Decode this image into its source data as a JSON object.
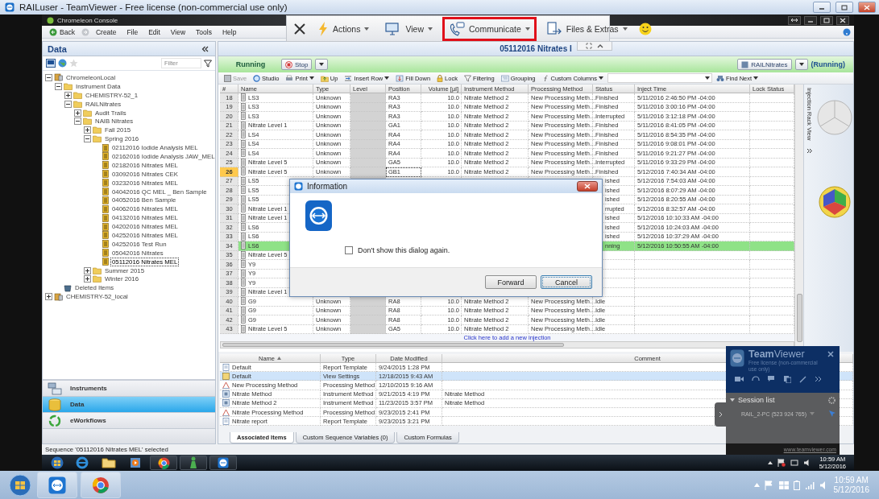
{
  "teamviewer_title": "RAILuser - TeamViewer - Free license (non-commercial use only)",
  "remote_toolbar": {
    "items": [
      {
        "label": "Actions",
        "highlighted": false
      },
      {
        "label": "View",
        "highlighted": false
      },
      {
        "label": "Communicate",
        "highlighted": true
      },
      {
        "label": "Files & Extras",
        "highlighted": false
      }
    ]
  },
  "app": {
    "title": "Chromeleon Console",
    "menu": [
      "Back",
      "Create",
      "File",
      "Edit",
      "View",
      "Tools",
      "Help"
    ]
  },
  "data_panel": {
    "title": "Data",
    "filter": {
      "placeholder": "Filter"
    },
    "tree": [
      {
        "label": "ChromeleonLocal",
        "kind": "server",
        "expanded": true,
        "selected": false,
        "children": [
          {
            "label": "Instrument Data",
            "kind": "folder",
            "expanded": true,
            "selected": false,
            "children": [
              {
                "label": "CHEMISTRY-52_1",
                "kind": "folder",
                "expanded": false,
                "selected": false
              },
              {
                "label": "RAILNitrates",
                "kind": "folder",
                "expanded": true,
                "selected": false,
                "children": [
                  {
                    "label": "Audit Trails",
                    "kind": "folder",
                    "expanded": false,
                    "selected": false
                  },
                  {
                    "label": "NAIB Nitrates",
                    "kind": "folder",
                    "expanded": true,
                    "selected": false,
                    "children": [
                      {
                        "label": "Fall 2015",
                        "kind": "folder",
                        "expanded": false,
                        "selected": false
                      },
                      {
                        "label": "Spring 2016",
                        "kind": "folder",
                        "expanded": true,
                        "selected": false,
                        "children": [
                          {
                            "label": "02112016 Iodide Analysis MEL",
                            "kind": "sequence",
                            "selected": false
                          },
                          {
                            "label": "02162016 Iodide Analysis JAW_MEL",
                            "kind": "sequence",
                            "selected": false
                          },
                          {
                            "label": "02182016 Nitrates MEL",
                            "kind": "sequence",
                            "selected": false
                          },
                          {
                            "label": "03092016 Nitrates CEK",
                            "kind": "sequence",
                            "selected": false
                          },
                          {
                            "label": "03232016 Nitrates MEL",
                            "kind": "sequence",
                            "selected": false
                          },
                          {
                            "label": "04042016 QC MEL _ Ben Sample",
                            "kind": "sequence",
                            "selected": false
                          },
                          {
                            "label": "04052016 Ben Sample",
                            "kind": "sequence",
                            "selected": false
                          },
                          {
                            "label": "04062016 Nitrates MEL",
                            "kind": "sequence",
                            "selected": false
                          },
                          {
                            "label": "04132016 Nitrates MEL",
                            "kind": "sequence",
                            "selected": false
                          },
                          {
                            "label": "04202016 Nitrates MEL",
                            "kind": "sequence",
                            "selected": false
                          },
                          {
                            "label": "04252016 Nitrates MEL",
                            "kind": "sequence",
                            "selected": false
                          },
                          {
                            "label": "04252016 Test Run",
                            "kind": "sequence",
                            "selected": false
                          },
                          {
                            "label": "05042016 Nitrates",
                            "kind": "sequence",
                            "selected": false
                          },
                          {
                            "label": "05112016 Nitrates MEL",
                            "kind": "sequence",
                            "selected": true
                          }
                        ]
                      },
                      {
                        "label": "Summer 2015",
                        "kind": "folder",
                        "expanded": false,
                        "selected": false
                      },
                      {
                        "label": "Winter 2016",
                        "kind": "folder",
                        "expanded": false,
                        "selected": false
                      }
                    ]
                  }
                ]
              }
            ]
          },
          {
            "label": "Deleted Items",
            "kind": "trash",
            "selected": false
          }
        ]
      },
      {
        "label": "CHEMISTRY-52_local",
        "kind": "server",
        "expanded": false,
        "selected": false
      }
    ],
    "nav": [
      {
        "label": "Instruments",
        "selected": false
      },
      {
        "label": "Data",
        "selected": true
      },
      {
        "label": "eWorkflows",
        "selected": false
      }
    ]
  },
  "sequence": {
    "title": "05112016 Nitrates I",
    "state": "Running",
    "stop": "Stop",
    "instrument": "RAILNitrates",
    "instrument_state": "(Running)",
    "toolbar": [
      {
        "label": "Save",
        "disabled": true,
        "menu": false
      },
      {
        "label": "Studio",
        "disabled": false,
        "menu": false
      },
      {
        "label": "Print",
        "disabled": false,
        "menu": true
      },
      {
        "label": "Up",
        "disabled": false,
        "menu": false
      },
      {
        "label": "Insert Row",
        "disabled": false,
        "menu": true
      },
      {
        "label": "Fill Down",
        "disabled": false,
        "menu": false
      },
      {
        "label": "Lock",
        "disabled": false,
        "menu": false
      },
      {
        "label": "Filtering",
        "disabled": false,
        "menu": false
      },
      {
        "label": "Grouping",
        "disabled": false,
        "menu": false
      },
      {
        "label": "Custom Columns",
        "disabled": false,
        "menu": true
      }
    ],
    "find": "Find Next",
    "columns": [
      "#",
      "Name",
      "Type",
      "Level",
      "Position",
      "Volume [µl]",
      "Instrument Method",
      "Processing Method",
      "Status",
      "Inject Time",
      "Lock Status"
    ],
    "rows": [
      {
        "no": "18",
        "name": "LS3",
        "type": "Unknown",
        "position": "RA3",
        "volume": "10.0",
        "instrument_method": "Nitrate Method 2",
        "processing_method": "New Processing Meth…",
        "status": "Finished",
        "inject_time": "5/11/2016 2:46:50 PM -04:00",
        "kind": "row",
        "current": false,
        "selected": false
      },
      {
        "no": "19",
        "name": "LS3",
        "type": "Unknown",
        "position": "RA3",
        "volume": "10.0",
        "instrument_method": "Nitrate Method 2",
        "processing_method": "New Processing Meth…",
        "status": "Finished",
        "inject_time": "5/11/2016 3:00:16 PM -04:00",
        "kind": "row",
        "current": false,
        "selected": false
      },
      {
        "no": "20",
        "name": "LS3",
        "type": "Unknown",
        "position": "RA3",
        "volume": "10.0",
        "instrument_method": "Nitrate Method 2",
        "processing_method": "New Processing Meth…",
        "status": "Interrupted",
        "inject_time": "5/11/2016 3:12:18 PM -04:00",
        "kind": "row",
        "current": false,
        "selected": false
      },
      {
        "no": "21",
        "name": "Nitrate Level 1",
        "type": "Unknown",
        "position": "GA1",
        "volume": "10.0",
        "instrument_method": "Nitrate Method 2",
        "processing_method": "New Processing Meth…",
        "status": "Finished",
        "inject_time": "5/11/2016 8:41:05 PM -04:00",
        "kind": "row",
        "current": false,
        "selected": false
      },
      {
        "no": "22",
        "name": "LS4",
        "type": "Unknown",
        "position": "RA4",
        "volume": "10.0",
        "instrument_method": "Nitrate Method 2",
        "processing_method": "New Processing Meth…",
        "status": "Finished",
        "inject_time": "5/11/2016 8:54:35 PM -04:00",
        "kind": "row",
        "current": false,
        "selected": false
      },
      {
        "no": "23",
        "name": "LS4",
        "type": "Unknown",
        "position": "RA4",
        "volume": "10.0",
        "instrument_method": "Nitrate Method 2",
        "processing_method": "New Processing Meth…",
        "status": "Finished",
        "inject_time": "5/11/2016 9:08:01 PM -04:00",
        "kind": "row",
        "current": false,
        "selected": false
      },
      {
        "no": "24",
        "name": "LS4",
        "type": "Unknown",
        "position": "RA4",
        "volume": "10.0",
        "instrument_method": "Nitrate Method 2",
        "processing_method": "New Processing Meth…",
        "status": "Finished",
        "inject_time": "5/11/2016 9:21:27 PM -04:00",
        "kind": "row",
        "current": false,
        "selected": false
      },
      {
        "no": "25",
        "name": "Nitrate Level 5",
        "type": "Unknown",
        "position": "GA5",
        "volume": "10.0",
        "instrument_method": "Nitrate Method 2",
        "processing_method": "New Processing Meth…",
        "status": "Interrupted",
        "inject_time": "5/11/2016 9:33:29 PM -04:00",
        "kind": "row",
        "current": false,
        "selected": false
      },
      {
        "no": "26",
        "name": "Nitrate Level 5",
        "type": "Unknown",
        "position": "GB1",
        "volume": "10.0",
        "instrument_method": "Nitrate Method 2",
        "processing_method": "New Processing Meth…",
        "status": "Finished",
        "inject_time": "5/12/2016 7:40:34 AM -04:00",
        "kind": "row",
        "current": true,
        "selected": false
      },
      {
        "no": "27",
        "name": "LS5",
        "status": "ished",
        "inject_time": "5/12/2016 7:54:03 AM -04:00",
        "kind": "covered",
        "current": false,
        "selected": false
      },
      {
        "no": "28",
        "name": "LS5",
        "status": "ished",
        "inject_time": "5/12/2016 8:07:29 AM -04:00",
        "kind": "covered",
        "current": false,
        "selected": false
      },
      {
        "no": "29",
        "name": "LS5",
        "status": "ished",
        "inject_time": "5/12/2016 8:20:55 AM -04:00",
        "kind": "covered",
        "current": false,
        "selected": false
      },
      {
        "no": "30",
        "name": "Nitrate Level 1",
        "status": "rrupted",
        "inject_time": "5/12/2016 8:32:57 AM -04:00",
        "kind": "covered",
        "current": false,
        "selected": false
      },
      {
        "no": "31",
        "name": "Nitrate Level 1",
        "status": "ished",
        "inject_time": "5/12/2016 10:10:33 AM -04:00",
        "kind": "covered",
        "current": false,
        "selected": false
      },
      {
        "no": "32",
        "name": "LS6",
        "status": "ished",
        "inject_time": "5/12/2016 10:24:03 AM -04:00",
        "kind": "covered",
        "current": false,
        "selected": false
      },
      {
        "no": "33",
        "name": "LS6",
        "status": "ished",
        "inject_time": "5/12/2016 10:37:29 AM -04:00",
        "kind": "covered",
        "current": false,
        "selected": false
      },
      {
        "no": "34",
        "name": "LS6",
        "status": "nning",
        "inject_time": "5/12/2016 10:50:55 AM -04:00",
        "kind": "covered",
        "current": false,
        "selected": true
      },
      {
        "no": "35",
        "name": "Nitrate Level 5",
        "kind": "covered",
        "current": false,
        "selected": false
      },
      {
        "no": "36",
        "name": "Y9",
        "kind": "covered",
        "current": false,
        "selected": false
      },
      {
        "no": "37",
        "name": "Y9",
        "kind": "covered",
        "current": false,
        "selected": false
      },
      {
        "no": "38",
        "name": "Y9",
        "kind": "covered",
        "current": false,
        "selected": false
      },
      {
        "no": "39",
        "name": "Nitrate Level 1",
        "kind": "covered",
        "current": false,
        "selected": false
      },
      {
        "no": "40",
        "name": "G9",
        "type": "Unknown",
        "position": "RA8",
        "volume": "10.0",
        "instrument_method": "Nitrate Method 2",
        "processing_method": "New Processing Meth…",
        "status": "Idle",
        "kind": "row",
        "current": false,
        "selected": false
      },
      {
        "no": "41",
        "name": "G9",
        "type": "Unknown",
        "position": "RA8",
        "volume": "10.0",
        "instrument_method": "Nitrate Method 2",
        "processing_method": "New Processing Meth…",
        "status": "Idle",
        "kind": "row",
        "current": false,
        "selected": false
      },
      {
        "no": "42",
        "name": "G9",
        "type": "Unknown",
        "position": "RA8",
        "volume": "10.0",
        "instrument_method": "Nitrate Method 2",
        "processing_method": "New Processing Meth…",
        "status": "Idle",
        "kind": "row",
        "current": false,
        "selected": false
      },
      {
        "no": "43",
        "name": "Nitrate Level 5",
        "type": "Unknown",
        "position": "GA5",
        "volume": "10.0",
        "instrument_method": "Nitrate Method 2",
        "processing_method": "New Processing Meth…",
        "status": "Idle",
        "kind": "row",
        "current": false,
        "selected": false
      }
    ],
    "add_link": "Click here to add a new injection"
  },
  "rack_view": {
    "title": "Injection Rack View"
  },
  "items_table": {
    "columns": [
      "Name",
      "Type",
      "Date Modified",
      "Comment"
    ],
    "rows": [
      {
        "name": "Default",
        "type": "Report Template",
        "date": "9/24/2015 1:28 PM",
        "selected": false
      },
      {
        "name": "Default",
        "type": "View Settings",
        "date": "12/18/2015 9:43 AM",
        "selected": true
      },
      {
        "name": "New Processing Method",
        "type": "Processing Method",
        "date": "12/10/2015 9:16 AM",
        "selected": false
      },
      {
        "name": "Nitrate Method",
        "type": "Instrument Method",
        "date": "9/21/2015 4:19 PM",
        "comment": "Nitrate Method",
        "selected": false
      },
      {
        "name": "Nitrate Method 2",
        "type": "Instrument Method",
        "date": "11/23/2015 3:57 PM",
        "comment": "Nitrate Method",
        "selected": false
      },
      {
        "name": "Nitrate Processing Method",
        "type": "Processing Method",
        "date": "9/23/2015 2:41 PM",
        "selected": false
      },
      {
        "name": "Nitrate report",
        "type": "Report Template",
        "date": "9/23/2015 3:21 PM",
        "selected": false
      }
    ],
    "tabs": [
      {
        "label": "Associated Items",
        "selected": true
      },
      {
        "label": "Custom Sequence Variables (0)",
        "selected": false
      },
      {
        "label": "Custom Formulas",
        "selected": false
      }
    ]
  },
  "status_bar": "Sequence '05112016 Nitrates MEL' selected",
  "dialog": {
    "title": "Information",
    "checkbox": {
      "label": "Don't show this dialog again.",
      "checked": false
    },
    "buttons": [
      {
        "label": "Forward",
        "focused": false
      },
      {
        "label": "Cancel",
        "focused": true
      }
    ]
  },
  "teamviewer_panel": {
    "brand": "**Team**Viewer",
    "license": "Free license (non-commercial use only)",
    "session_title": "Session list",
    "session": "RAIL_2-PC (523 924 765)",
    "link": "www.teamviewer.com"
  },
  "remote_taskbar": {
    "time": "10:59 AM",
    "date": "5/12/2016"
  },
  "local_taskbar": {
    "time": "10:59 AM",
    "date": "5/12/2016"
  }
}
